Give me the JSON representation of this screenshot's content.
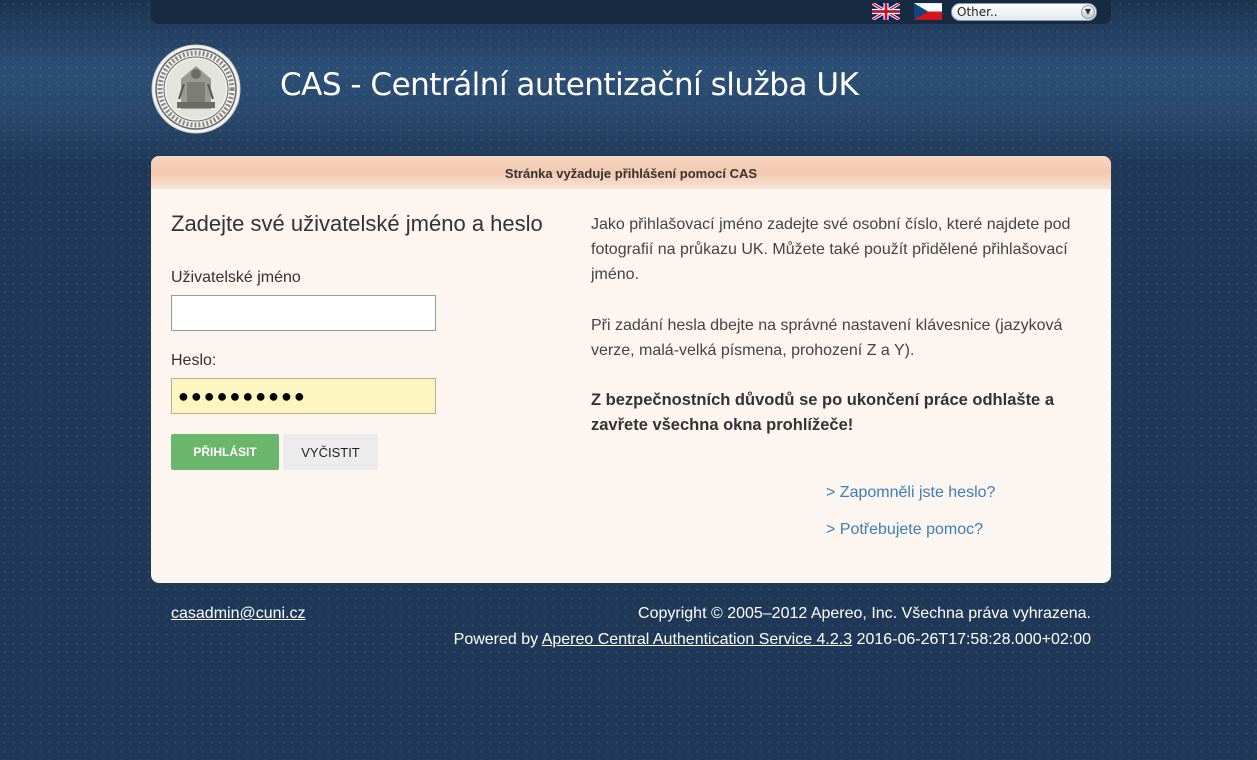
{
  "topbar": {
    "flag_uk_icon": "uk-flag-icon",
    "flag_cz_icon": "cz-flag-icon",
    "language_select_value": "Other.."
  },
  "header": {
    "logo_icon": "university-seal-icon",
    "title": "CAS - Centrální autentizační služba UK"
  },
  "panel": {
    "notice": "Stránka vyžaduje přihlášení pomocí CAS",
    "login_title": "Zadejte své uživatelské jméno a heslo",
    "username_label": "Uživatelské jméno",
    "username_value": "",
    "password_label": "Heslo:",
    "password_value": "●●●●●●●●●●",
    "login_button": "PŘIHLÁSIT",
    "clear_button": "VYČISTIT",
    "info_1": "Jako přihlašovací jméno zadejte své osobní číslo, které najdete pod fotografií na průkazu UK. Můžete také použít přidělené přihlašovací jméno.",
    "info_2": "Při zadání hesla dbejte na správné nastavení klávesnice (jazyková verze, malá-velká písmena, prohození Z a Y).",
    "info_3": "Z bezpečnostních důvodů se po ukončení práce odhlašte a zavřete všechna okna prohlížeče!",
    "forgot_link": "> Zapomněli jste heslo?",
    "help_link": "> Potřebujete pomoc?"
  },
  "footer": {
    "email": "casadmin@cuni.cz",
    "copyright": "Copyright © 2005–2012 Apereo, Inc. Všechna práva vyhrazena.",
    "powered_prefix": "Powered by ",
    "powered_link": "Apereo Central Authentication Service 4.2.3",
    "powered_suffix": " 2016-06-26T17:58:28.000+02:00"
  },
  "colors": {
    "background": "#1f3857",
    "panel": "#fdf5ef",
    "login_button": "#6ab66a",
    "link": "#3a7fb8",
    "password_field": "#fdf6c1"
  }
}
